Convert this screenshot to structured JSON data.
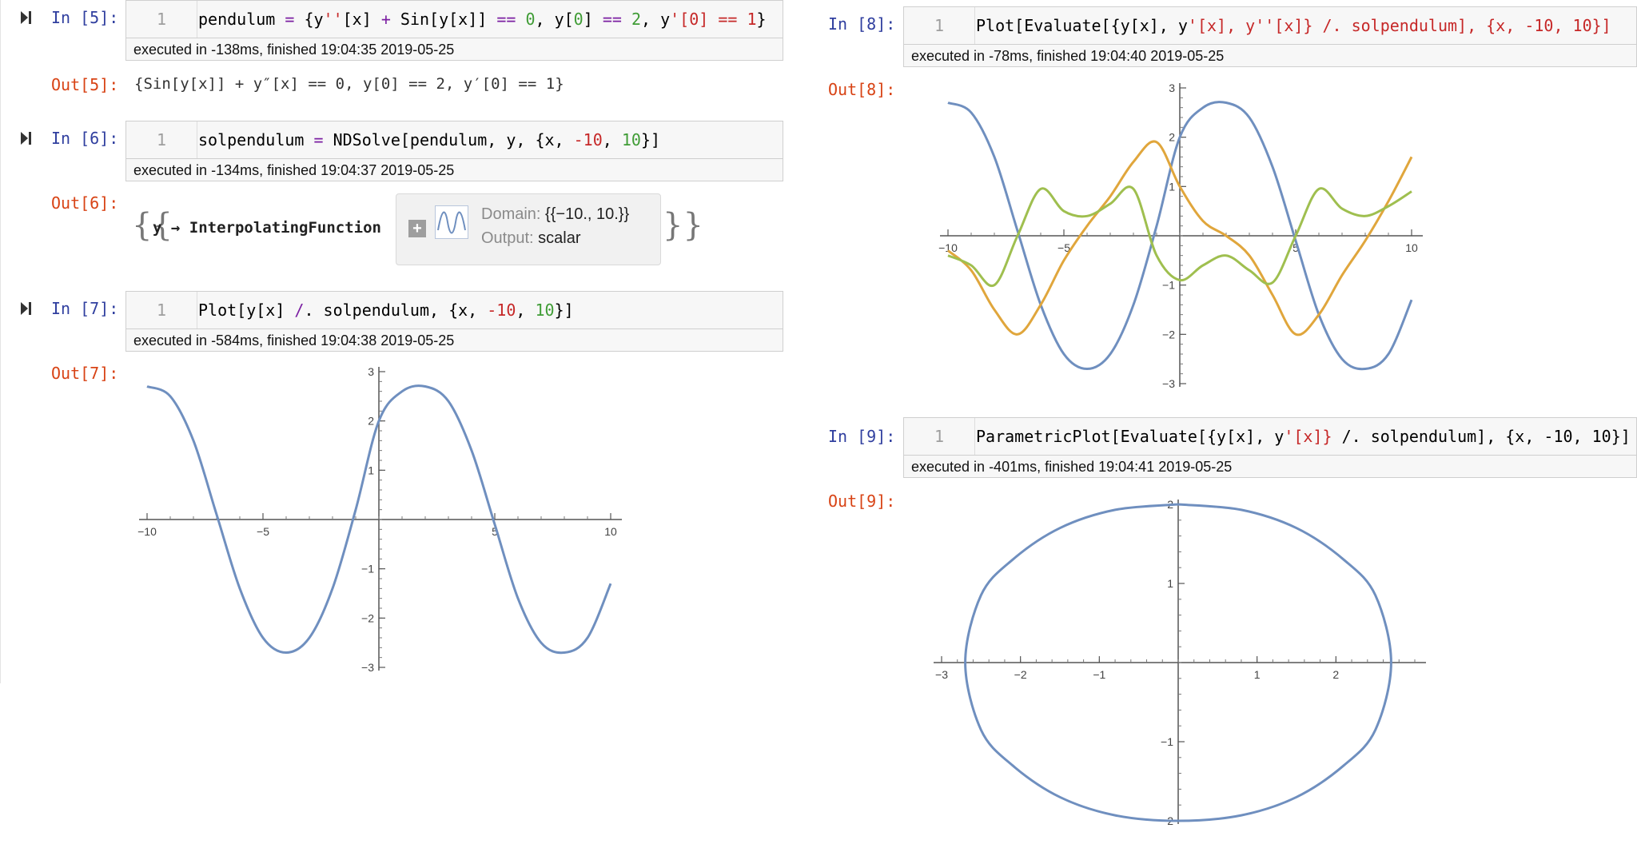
{
  "colors": {
    "in_prompt": "#303f9f",
    "out_prompt": "#d84315",
    "operator": "#7b1fa2",
    "number": "#3f9c35",
    "string": "#c62828",
    "series_1": "#6f8fbf",
    "series_2": "#e0a63c",
    "series_3": "#9fbf4f"
  },
  "cells": {
    "c5": {
      "in_label": "In [5]:",
      "line_no": "1",
      "code": {
        "a": "pendulum ",
        "b": "=",
        "c": " {y",
        "d": "''",
        "e": "[x] ",
        "f": "+",
        "g": " Sin[y[x]] ",
        "h": "==",
        "i": " ",
        "j": "0",
        "k": ", y[",
        "l": "0",
        "m": "] ",
        "n": "==",
        "o": " ",
        "p": "2",
        "q": ", y",
        "r": "'[0] == 1",
        "s": "}"
      },
      "status": "executed in -138ms, finished 19:04:35 2019-05-25",
      "out_label": "Out[5]:",
      "output": "{Sin[y[x]] + y″[x] == 0, y[0] == 2, y′[0] == 1}"
    },
    "c6": {
      "in_label": "In [6]:",
      "line_no": "1",
      "code": {
        "a": "solpendulum ",
        "b": "=",
        "c": " NDSolve[pendulum, y, {x, ",
        "d": "-10",
        "e": ", ",
        "f": "10",
        "g": "}]"
      },
      "status": "executed in -134ms, finished 19:04:37 2019-05-25",
      "out_label": "Out[6]:",
      "output": {
        "open": "{{",
        "arrow": "y → InterpolatingFunction",
        "domain_label": "Domain:",
        "domain_value": "{{−10., 10.}}",
        "output_label": "Output:",
        "output_value": "scalar",
        "close": "}}"
      }
    },
    "c7": {
      "in_label": "In [7]:",
      "line_no": "1",
      "code": {
        "a": "Plot[y[x] ",
        "b": "/",
        "c": ". solpendulum, {x, ",
        "d": "-10",
        "e": ", ",
        "f": "10",
        "g": "}]"
      },
      "status": "executed in -584ms, finished 19:04:38 2019-05-25",
      "out_label": "Out[7]:"
    },
    "c8": {
      "in_label": "In [8]:",
      "line_no": "1",
      "code": {
        "a": "Plot[Evaluate[{y[x], y",
        "b": "'[x], y''[x]} /. solpendulum], {x, -10, 10}]"
      },
      "status": "executed in -78ms, finished 19:04:40 2019-05-25",
      "out_label": "Out[8]:"
    },
    "c9": {
      "in_label": "In [9]:",
      "line_no": "1",
      "code": {
        "a": "ParametricPlot[Evaluate[{y[x], y",
        "b": "'[x]}",
        "c": " /. solpendulum], {x, -10, 10}]"
      },
      "status": "executed in -401ms, finished 19:04:41 2019-05-25",
      "out_label": "Out[9]:"
    }
  },
  "chart_data": [
    {
      "type": "line",
      "xlim": [
        -10,
        10
      ],
      "ylim": [
        -3,
        3
      ],
      "x_ticks": [
        "−10",
        "−5",
        "5",
        "10"
      ],
      "y_ticks": [
        "−3",
        "−2",
        "−1",
        "1",
        "2",
        "3"
      ],
      "series": [
        {
          "x": [
            -10,
            -9,
            -8,
            -7,
            -6,
            -5,
            -4,
            -3,
            -2,
            -1,
            0,
            1,
            2,
            3,
            4,
            5,
            6,
            7,
            8,
            9,
            10
          ],
          "values": [
            2.7,
            2.5,
            1.6,
            0.1,
            -1.4,
            -2.4,
            -2.7,
            -2.4,
            -1.4,
            0.2,
            2.0,
            2.6,
            2.7,
            2.4,
            1.4,
            -0.1,
            -1.6,
            -2.5,
            -2.7,
            -2.4,
            -1.3
          ]
        }
      ]
    },
    {
      "type": "line",
      "xlim": [
        -10,
        10
      ],
      "ylim": [
        -3,
        3
      ],
      "x_ticks": [
        "−10",
        "−5",
        "5",
        "10"
      ],
      "y_ticks": [
        "−3",
        "−2",
        "−1",
        "1",
        "2",
        "3"
      ],
      "series": [
        {
          "x": [
            -10,
            -9,
            -8,
            -7,
            -6,
            -5,
            -4,
            -3,
            -2,
            -1,
            0,
            1,
            2,
            3,
            4,
            5,
            6,
            7,
            8,
            9,
            10
          ],
          "values": [
            2.7,
            2.5,
            1.6,
            0.1,
            -1.4,
            -2.4,
            -2.7,
            -2.4,
            -1.4,
            0.2,
            2.0,
            2.6,
            2.7,
            2.4,
            1.4,
            -0.1,
            -1.6,
            -2.5,
            -2.7,
            -2.4,
            -1.3
          ]
        },
        {
          "x": [
            -10,
            -9,
            -8,
            -7,
            -6,
            -5,
            -4,
            -3,
            -2,
            -1,
            0,
            1,
            2,
            3,
            4,
            5,
            6,
            7,
            8,
            9,
            10
          ],
          "values": [
            -0.3,
            -0.7,
            -1.5,
            -2.0,
            -1.4,
            -0.5,
            0.2,
            0.8,
            1.5,
            1.9,
            1.0,
            0.3,
            0.0,
            -0.4,
            -1.2,
            -2.0,
            -1.6,
            -0.8,
            -0.1,
            0.7,
            1.6
          ]
        },
        {
          "x": [
            -10,
            -9,
            -8,
            -7,
            -6,
            -5,
            -4,
            -3,
            -2,
            -1,
            0,
            1,
            2,
            3,
            4,
            5,
            6,
            7,
            8,
            9,
            10
          ],
          "values": [
            -0.4,
            -0.6,
            -1.0,
            0.0,
            0.95,
            0.5,
            0.4,
            0.65,
            0.95,
            -0.4,
            -0.9,
            -0.6,
            -0.4,
            -0.7,
            -0.95,
            0.0,
            0.95,
            0.55,
            0.4,
            0.6,
            0.9
          ]
        }
      ]
    },
    {
      "type": "line",
      "xlim": [
        -3,
        3
      ],
      "ylim": [
        -2,
        2
      ],
      "x_ticks": [
        "−3",
        "−2",
        "−1",
        "1",
        "2"
      ],
      "y_ticks": [
        "−2",
        "−1",
        "1",
        "2"
      ],
      "series": [
        {
          "x": [
            0,
            0.8,
            1.5,
            2.1,
            2.5,
            2.7,
            2.5,
            2.1,
            1.5,
            0.8,
            0,
            -0.8,
            -1.5,
            -2.1,
            -2.5,
            -2.7,
            -2.5,
            -2.1,
            -1.5,
            -0.8,
            0
          ],
          "values": [
            2.0,
            1.93,
            1.7,
            1.3,
            0.85,
            0.0,
            -0.85,
            -1.3,
            -1.7,
            -1.93,
            -2.0,
            -1.93,
            -1.7,
            -1.3,
            -0.85,
            0.0,
            0.85,
            1.3,
            1.7,
            1.93,
            2.0
          ]
        }
      ]
    }
  ]
}
